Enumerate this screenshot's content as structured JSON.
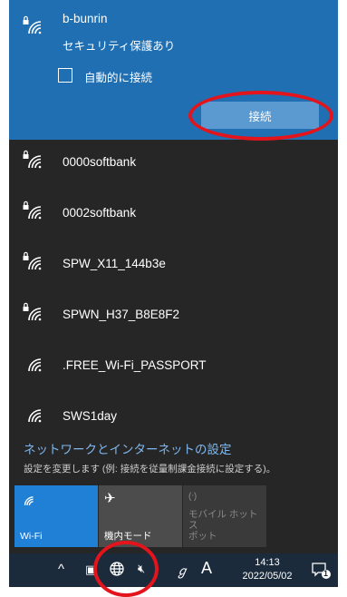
{
  "selected_network": {
    "name": "b-bunrin",
    "status": "セキュリティ保護あり",
    "auto_connect_label": "自動的に接続",
    "auto_connect_checked": false,
    "connect_label": "接続"
  },
  "networks": [
    {
      "name": "0000softbank",
      "secured": true,
      "icon": "wifi-secured-icon"
    },
    {
      "name": "0002softbank",
      "secured": true,
      "icon": "wifi-secured-icon"
    },
    {
      "name": "SPW_X11_144b3e",
      "secured": true,
      "icon": "wifi-secured-icon"
    },
    {
      "name": "SPWN_H37_B8E8F2",
      "secured": true,
      "icon": "wifi-secured-icon"
    },
    {
      "name": ".FREE_Wi-Fi_PASSPORT",
      "secured": false,
      "icon": "wifi-icon"
    },
    {
      "name": "SWS1day",
      "secured": false,
      "icon": "wifi-icon"
    }
  ],
  "settings": {
    "link": "ネットワークとインターネットの設定",
    "description": "設定を変更します (例: 接続を従量制課金接続に設定する)。"
  },
  "quick_actions": [
    {
      "label": "Wi-Fi",
      "active": true,
      "icon": "wifi-icon"
    },
    {
      "label": "機内モード",
      "active": false,
      "icon": "airplane-icon"
    },
    {
      "label": "モバイル ホットス\nポット",
      "active": false,
      "disabled": true,
      "icon": "hotspot-icon"
    }
  ],
  "taskbar": {
    "chevron": "^",
    "ime_mode": "A",
    "time": "14:13",
    "date": "2022/05/02",
    "notification_count": "1"
  },
  "colors": {
    "flyout_bg": "#262626",
    "selected_bg": "#1f6fb2",
    "connect_button": "#5a9ad0",
    "accent_tile": "#1f80d6",
    "link": "#7fb8ee",
    "annotation_red": "#e3141b",
    "taskbar_bg": "#1b2b3c"
  }
}
